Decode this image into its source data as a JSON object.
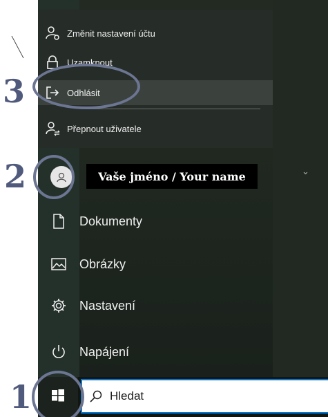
{
  "account_menu": {
    "items": [
      {
        "label": "Změnit nastavení účtu",
        "icon": "person-gear-icon"
      },
      {
        "label": "Uzamknout",
        "icon": "lock-icon"
      },
      {
        "label": "Odhlásit",
        "icon": "sign-out-icon"
      },
      {
        "label": "Přepnout uživatele",
        "icon": "switch-user-icon"
      }
    ]
  },
  "user": {
    "name": "Vaše jméno / Your name",
    "icon": "avatar-icon"
  },
  "nav": {
    "items": [
      {
        "label": "Dokumenty",
        "icon": "document-icon"
      },
      {
        "label": "Obrázky",
        "icon": "pictures-icon"
      },
      {
        "label": "Nastavení",
        "icon": "settings-gear-icon"
      },
      {
        "label": "Napájení",
        "icon": "power-icon"
      }
    ]
  },
  "taskbar": {
    "search_placeholder": "Hledat",
    "start_icon": "windows-logo-icon"
  },
  "annotations": {
    "steps": [
      "1",
      "2",
      "3"
    ],
    "color": "#505a7c"
  },
  "colors": {
    "search_border": "#0078d7",
    "highlight": "#3b423e"
  }
}
